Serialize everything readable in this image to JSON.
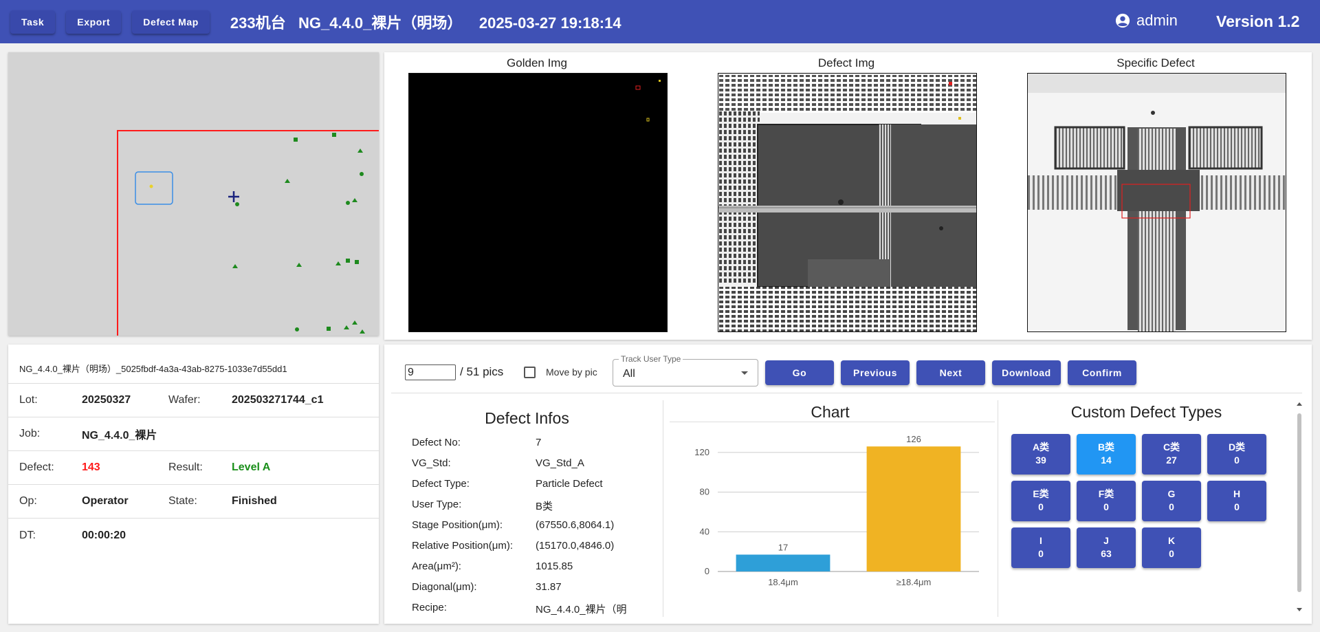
{
  "header": {
    "buttons": [
      "Task",
      "Export",
      "Defect Map"
    ],
    "machine": "233机台",
    "recipe": "NG_4.4.0_裸片（明场）",
    "datetime": "2025-03-27 19:18:14",
    "user": "admin",
    "version": "Version 1.2",
    "user_icon": "account-circle-icon"
  },
  "images": {
    "golden_title": "Golden Img",
    "defect_title": "Defect Img",
    "specific_title": "Specific Defect"
  },
  "info": {
    "id": "NG_4.4.0_裸片（明场）_5025fbdf-4a3a-43ab-8275-1033e7d55dd1",
    "lot_label": "Lot:",
    "lot": "20250327",
    "wafer_label": "Wafer:",
    "wafer": "202503271744_c1",
    "job_label": "Job:",
    "job": "NG_4.4.0_裸片",
    "defect_label": "Defect:",
    "defect": "143",
    "result_label": "Result:",
    "result": "Level A",
    "op_label": "Op:",
    "op": "Operator",
    "state_label": "State:",
    "state": "Finished",
    "dt_label": "DT:",
    "dt": "00:00:20",
    "colors": {
      "defect": "#ff1a1a",
      "result": "#1a8f1a"
    }
  },
  "toolbar": {
    "pic_value": "9",
    "pic_total": "/ 51 pics",
    "move_by_pic": "Move by pic",
    "track_label": "Track User Type",
    "track_value": "All",
    "go": "Go",
    "previous": "Previous",
    "next": "Next",
    "download": "Download",
    "confirm": "Confirm"
  },
  "defect_infos": {
    "title": "Defect Infos",
    "rows": [
      {
        "k": "Defect No:",
        "v": "7"
      },
      {
        "k": "VG_Std:",
        "v": "VG_Std_A"
      },
      {
        "k": "Defect Type:",
        "v": "Particle Defect"
      },
      {
        "k": "User Type:",
        "v": "B类"
      },
      {
        "k": "Stage Position(μm):",
        "v": "(67550.6,8064.1)"
      },
      {
        "k": "Relative Position(μm):",
        "v": "(15170.0,4846.0)"
      },
      {
        "k": "Area(μm²):",
        "v": "1015.85"
      },
      {
        "k": "Diagonal(μm):",
        "v": "31.87"
      },
      {
        "k": "Recipe:",
        "v": "NG_4.4.0_裸片（明"
      }
    ]
  },
  "chart_title": "Chart",
  "chart_data": {
    "type": "bar",
    "categories": [
      "18.4μm",
      "≥18.4μm"
    ],
    "values": [
      17,
      126
    ],
    "colors": [
      "#2e9fd8",
      "#f0b323"
    ],
    "ylim": [
      0,
      140
    ],
    "yticks": [
      0,
      40,
      80,
      120
    ],
    "grid": true
  },
  "custom_types": {
    "title": "Custom Defect Types",
    "selected_color": "#2196f3",
    "items": [
      {
        "name": "A类",
        "count": "39"
      },
      {
        "name": "B类",
        "count": "14",
        "selected": true
      },
      {
        "name": "C类",
        "count": "27"
      },
      {
        "name": "D类",
        "count": "0"
      },
      {
        "name": "E类",
        "count": "0"
      },
      {
        "name": "F类",
        "count": "0"
      },
      {
        "name": "G",
        "count": "0"
      },
      {
        "name": "H",
        "count": "0"
      },
      {
        "name": "I",
        "count": "0"
      },
      {
        "name": "J",
        "count": "63"
      },
      {
        "name": "K",
        "count": "0"
      }
    ]
  }
}
